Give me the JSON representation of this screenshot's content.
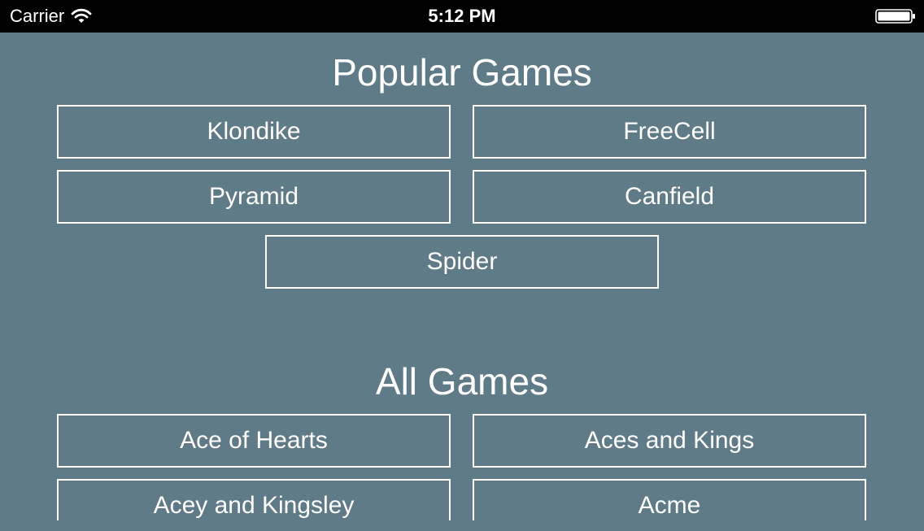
{
  "status_bar": {
    "carrier": "Carrier",
    "time": "5:12 PM",
    "wifi_icon": "wifi-icon",
    "battery_icon": "battery-icon"
  },
  "popular_games": {
    "title": "Popular Games",
    "items": [
      {
        "label": "Klondike"
      },
      {
        "label": "FreeCell"
      },
      {
        "label": "Pyramid"
      },
      {
        "label": "Canfield"
      },
      {
        "label": "Spider"
      }
    ]
  },
  "all_games": {
    "title": "All Games",
    "items": [
      {
        "label": "Ace of Hearts"
      },
      {
        "label": "Aces and Kings"
      },
      {
        "label": "Acey and Kingsley"
      },
      {
        "label": "Acme"
      }
    ]
  },
  "colors": {
    "background": "#607b88",
    "status_bar": "#000000",
    "button_border": "#ffffff",
    "text": "#ffffff"
  }
}
